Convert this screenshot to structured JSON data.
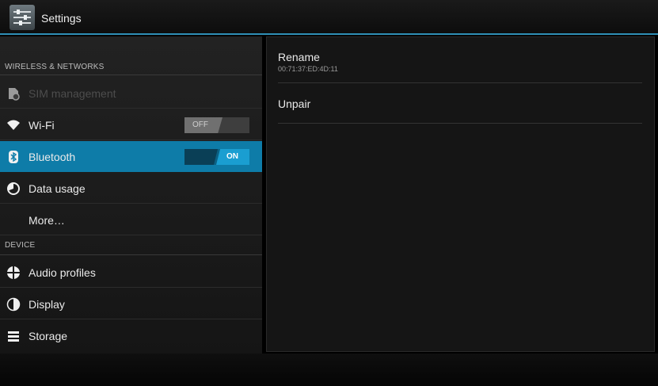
{
  "actionbar": {
    "title": "Settings",
    "icon": "settings-app-icon"
  },
  "sections": {
    "wireless": "WIRELESS & NETWORKS",
    "device": "DEVICE"
  },
  "items": {
    "sim": {
      "label": "SIM management",
      "icon": "sim-icon",
      "enabled": false
    },
    "wifi": {
      "label": "Wi-Fi",
      "icon": "wifi-icon",
      "toggle": "OFF"
    },
    "bluetooth": {
      "label": "Bluetooth",
      "icon": "bluetooth-icon",
      "toggle": "ON",
      "selected": true
    },
    "data": {
      "label": "Data usage",
      "icon": "data-usage-icon"
    },
    "more": {
      "label": "More…"
    },
    "audio": {
      "label": "Audio profiles",
      "icon": "audio-profiles-icon"
    },
    "display": {
      "label": "Display",
      "icon": "display-icon"
    },
    "storage": {
      "label": "Storage",
      "icon": "storage-icon"
    }
  },
  "detail": {
    "rename": {
      "title": "Rename",
      "subtitle": "00:71:37:ED:4D:11"
    },
    "unpair": {
      "title": "Unpair"
    }
  },
  "colors": {
    "accent": "#0e7ca8",
    "actionbar_line": "#2f8fb6",
    "background": "#000000"
  }
}
